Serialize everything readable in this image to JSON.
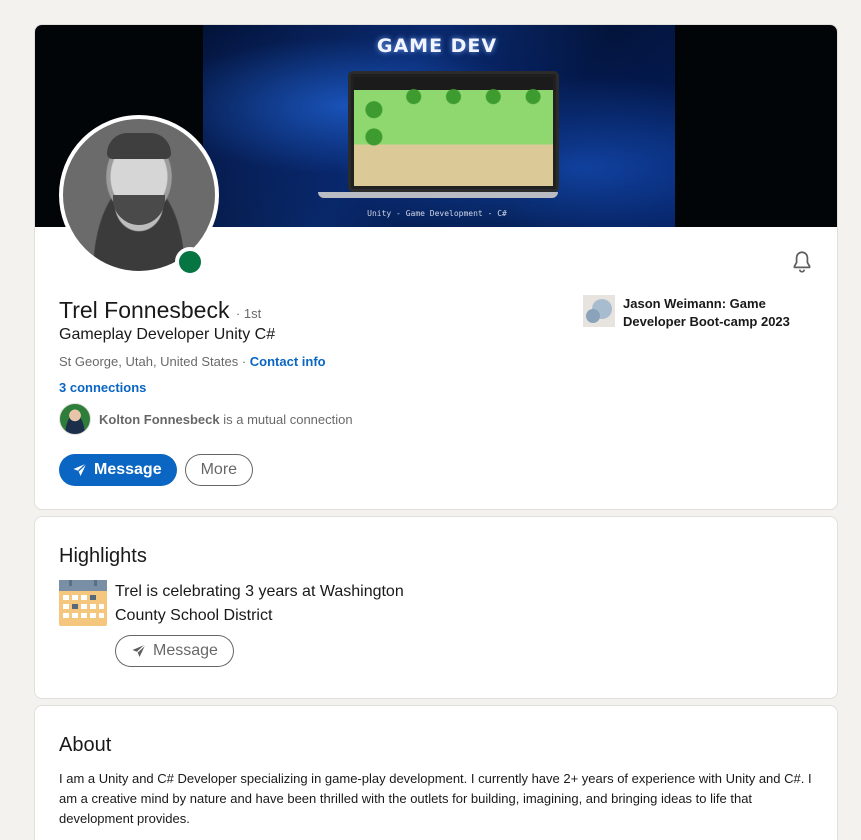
{
  "profile": {
    "banner": {
      "title": "GAME DEV",
      "caption": "Unity - Game Development - C#"
    },
    "name": "Trel Fonnesbeck",
    "degree": "· 1st",
    "headline": "Gameplay Developer Unity C#",
    "location": "St George, Utah, United States",
    "location_separator": " · ",
    "contact_info_label": "Contact info",
    "connections_label": "3 connections",
    "mutual": {
      "name": "Kolton Fonnesbeck",
      "suffix": " is a mutual connection"
    },
    "education": "Jason Weimann: Game Developer Boot-camp 2023",
    "buttons": {
      "message": "Message",
      "more": "More"
    },
    "online_status_color": "#057642",
    "accent_color": "#0a66c2",
    "icons": {
      "bell": "bell-icon",
      "send": "send-icon"
    }
  },
  "highlights": {
    "title": "Highlights",
    "text": "Trel is celebrating 3 years at Washington County School District",
    "button_label": "Message",
    "icon": "calendar-icon"
  },
  "about": {
    "title": "About",
    "text": "I am a Unity and C# Developer specializing in game-play development. I currently have 2+ years of experience with Unity and C#. I am a creative mind by nature and have been thrilled with the outlets for building, imagining, and bringing ideas to life that development provides."
  }
}
